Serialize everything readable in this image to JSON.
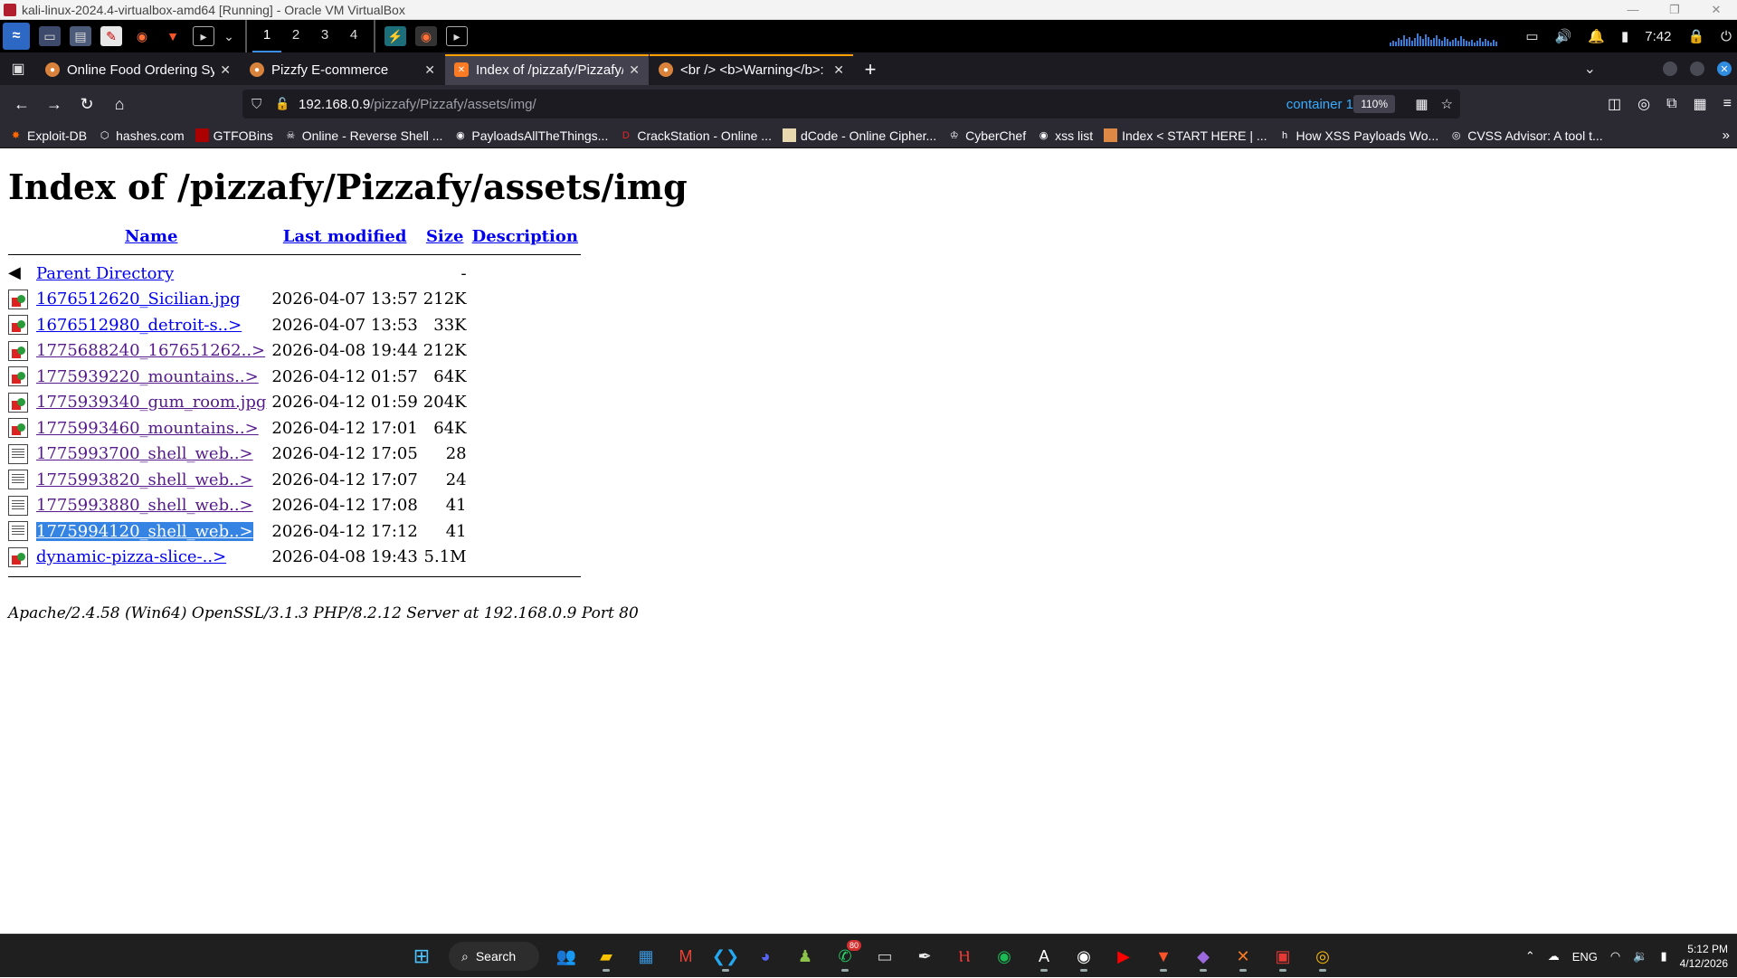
{
  "vbox": {
    "title": "kali-linux-2024.4-virtualbox-amd64 [Running] - Oracle VM VirtualBox"
  },
  "kali_panel": {
    "workspaces": [
      "1",
      "2",
      "3",
      "4"
    ],
    "time": "7:42"
  },
  "browser": {
    "tabs": [
      {
        "label": "Online Food Ordering Sys",
        "icon": "food-icon"
      },
      {
        "label": "Pizzfy E-commerce",
        "icon": "food-icon"
      },
      {
        "label": "Index of /pizzafy/Pizzafy/a",
        "icon": "xampp-icon"
      },
      {
        "label": "<br /> <b>Warning</b>: U",
        "icon": "food-icon"
      }
    ],
    "url_host": "192.168.0.9",
    "url_path": "/pizzafy/Pizzafy/assets/img/",
    "container": "container 1",
    "zoom": "110%",
    "bookmarks": [
      "Exploit-DB",
      "hashes.com",
      "GTFOBins",
      "Online - Reverse Shell ...",
      "PayloadsAllTheThings...",
      "CrackStation - Online ...",
      "dCode - Online Cipher...",
      "CyberChef",
      "xss list",
      "Index < START HERE | ...",
      "How XSS Payloads Wo...",
      "CVSS Advisor: A tool t..."
    ]
  },
  "page": {
    "heading": "Index of /pizzafy/Pizzafy/assets/img",
    "columns": {
      "name": "Name",
      "modified": "Last modified",
      "size": "Size",
      "description": "Description"
    },
    "parent": {
      "name": "Parent Directory",
      "size": "-"
    },
    "rows": [
      {
        "name": "1676512620_Sicilian.jpg",
        "modified": "2026-04-07 13:57",
        "size": "212K",
        "type": "img",
        "visited": false
      },
      {
        "name": "1676512980_detroit-s..>",
        "modified": "2026-04-07 13:53",
        "size": "33K",
        "type": "img",
        "visited": false
      },
      {
        "name": "1775688240_167651262..>",
        "modified": "2026-04-08 19:44",
        "size": "212K",
        "type": "img",
        "visited": true
      },
      {
        "name": "1775939220_mountains..>",
        "modified": "2026-04-12 01:57",
        "size": "64K",
        "type": "img",
        "visited": true
      },
      {
        "name": "1775939340_gum_room.jpg",
        "modified": "2026-04-12 01:59",
        "size": "204K",
        "type": "img",
        "visited": true
      },
      {
        "name": "1775993460_mountains..>",
        "modified": "2026-04-12 17:01",
        "size": "64K",
        "type": "img",
        "visited": true
      },
      {
        "name": "1775993700_shell_web..>",
        "modified": "2026-04-12 17:05",
        "size": "28",
        "type": "txt",
        "visited": true
      },
      {
        "name": "1775993820_shell_web..>",
        "modified": "2026-04-12 17:07",
        "size": "24",
        "type": "txt",
        "visited": true
      },
      {
        "name": "1775993880_shell_web..>",
        "modified": "2026-04-12 17:08",
        "size": "41",
        "type": "txt",
        "visited": true
      },
      {
        "name": "1775994120_shell_web..>",
        "modified": "2026-04-12 17:12",
        "size": "41",
        "type": "txt",
        "visited": true,
        "selected": true
      },
      {
        "name": "dynamic-pizza-slice-..>",
        "modified": "2026-04-08 19:43",
        "size": "5.1M",
        "type": "img",
        "visited": false
      }
    ],
    "address": "Apache/2.4.58 (Win64) OpenSSL/3.1.3 PHP/8.2.12 Server at 192.168.0.9 Port 80"
  },
  "taskbar": {
    "search_label": "Search",
    "whatsapp_badge": "80",
    "lang": "ENG",
    "time": "5:12 PM",
    "date": "4/12/2026"
  }
}
